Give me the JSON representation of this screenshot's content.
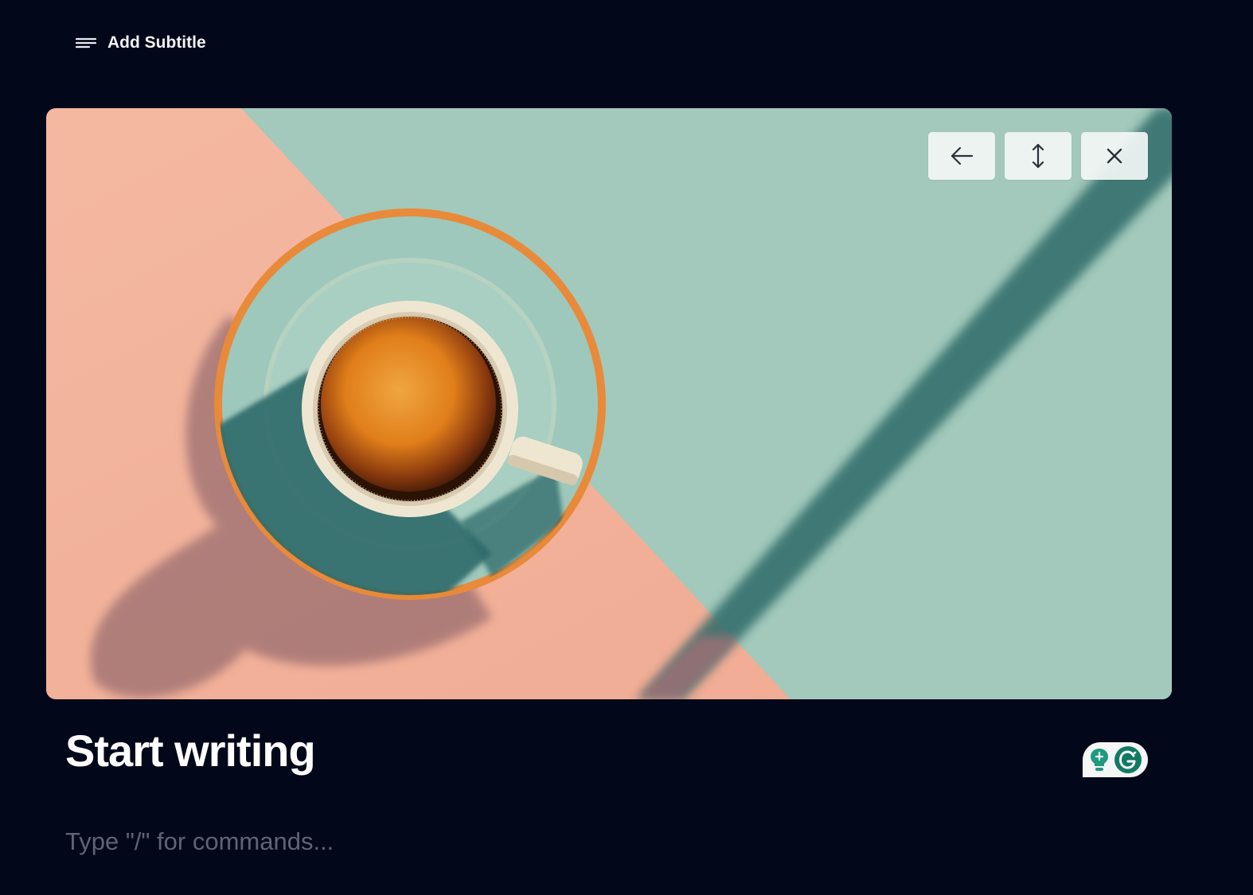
{
  "header": {
    "subtitle_button_label": "Add Subtitle",
    "subtitle_icon": "text-lines-icon"
  },
  "cover": {
    "image_description_icon": "coffee-cup-illustration",
    "toolbar": [
      {
        "name": "back-button",
        "icon": "arrow-left-icon"
      },
      {
        "name": "reposition-button",
        "icon": "arrows-vertical-icon"
      },
      {
        "name": "remove-cover-button",
        "icon": "close-icon"
      }
    ],
    "colors": {
      "peach": "#f2b49c",
      "mint": "#a2c9bb",
      "shadow_teal": "#2e6a68"
    }
  },
  "editor": {
    "title": "Start writing",
    "body_placeholder": "Type \"/\" for commands..."
  },
  "widgets": {
    "grammarly_icon": "grammarly-icon",
    "grammarly_accent": "#15c39a"
  },
  "colors": {
    "background": "#03071a",
    "text": "#ffffff",
    "placeholder": "#5e6474"
  }
}
